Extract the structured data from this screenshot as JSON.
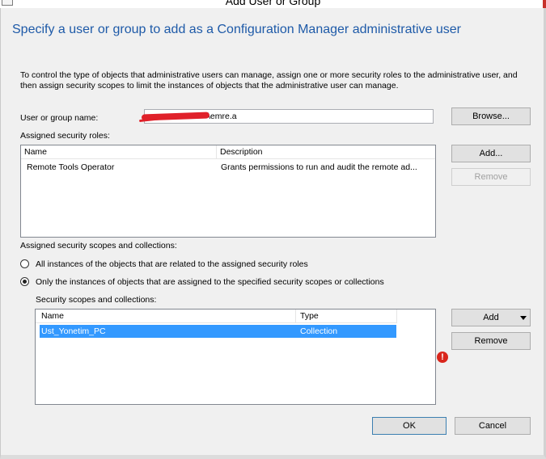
{
  "window": {
    "title": "Add User or Group"
  },
  "header": {
    "text": "Specify a user or group to add as a Configuration Manager administrative user"
  },
  "intro": {
    "line1": "To control the type of objects that administrative users can manage, assign one or more security roles  to the  administrative user, and",
    "line2": "then assign security scopes to limit the instances of objects that the administrative user can manage."
  },
  "user": {
    "label": "User or group name:",
    "value_suffix": "\\emre.a",
    "browse_label": "Browse..."
  },
  "roles": {
    "label": "Assigned security roles:",
    "columns": [
      "Name",
      "Description"
    ],
    "rows": [
      {
        "name": "Remote Tools Operator",
        "description": "Grants permissions to run and audit the remote ad..."
      }
    ],
    "add_label": "Add...",
    "remove_label": "Remove"
  },
  "scopes": {
    "label": "Assigned security scopes and collections:",
    "radio_all": "All instances of the objects that are related to the assigned security roles",
    "radio_only": "Only the instances of objects that are assigned to the specified security scopes or collections",
    "sub_label": "Security scopes and collections:",
    "columns": [
      "Name",
      "Type"
    ],
    "rows": [
      {
        "name": "Ust_Yonetim_PC",
        "type": "Collection"
      }
    ],
    "add_label": "Add",
    "remove_label": "Remove"
  },
  "footer": {
    "ok_label": "OK",
    "cancel_label": "Cancel"
  },
  "colors": {
    "header_blue": "#1e5aa8",
    "selection": "#3399ff",
    "error": "#d9261c"
  },
  "icons": {
    "error": "error-icon",
    "dropdown": "chevron-down-icon"
  }
}
